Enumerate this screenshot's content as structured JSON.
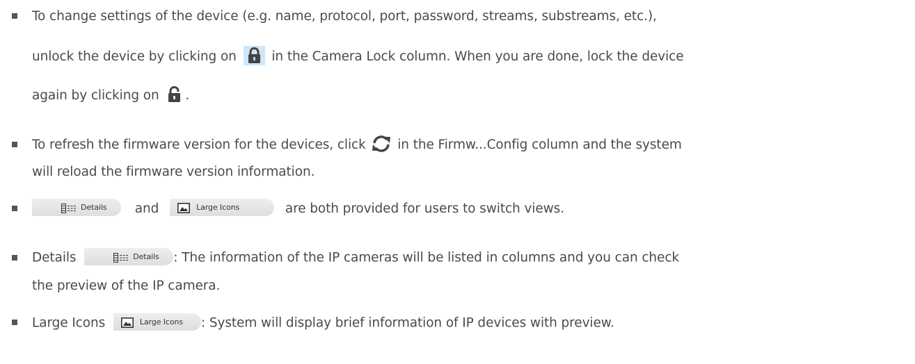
{
  "bullets": [
    {
      "lines": [
        "To change settings of the device (e.g. name, protocol, port, password, streams, substreams, etc.),",
        {
          "before": "unlock the device by clicking on",
          "after": "in the Camera Lock column. When you are done, lock the device"
        },
        {
          "before": "again by clicking on",
          "after": "."
        }
      ]
    },
    {
      "lines": [
        {
          "before": "To refresh the firmware version for the devices, click",
          "after": "in the Firmw...Config column and the system"
        },
        "will reload the firmware version information."
      ]
    },
    {
      "lines": [
        {
          "middle": "and",
          "after": "are both provided for users to switch views."
        }
      ]
    },
    {
      "lines": [
        {
          "before": "Details",
          "after": ": The information of the IP cameras will be listed in columns and you can check"
        },
        "the preview of the IP camera."
      ]
    },
    {
      "lines": [
        {
          "before": "Large Icons",
          "after": ": System will display brief information of IP devices with preview."
        }
      ]
    }
  ],
  "buttons": {
    "details_label": "Details",
    "large_icons_label": "Large Icons"
  },
  "icons": {
    "lock_closed": "lock-closed-icon",
    "lock_open": "lock-open-icon",
    "refresh": "refresh-icon",
    "details_view": "details-view-icon",
    "large_icons_view": "large-icons-view-icon"
  },
  "colors": {
    "text": "#4a4a4a",
    "bullet": "#555555",
    "lock_highlight": "#cfe6f7",
    "lock_icon": "#444444",
    "button_bg": "#e6e6e6"
  }
}
